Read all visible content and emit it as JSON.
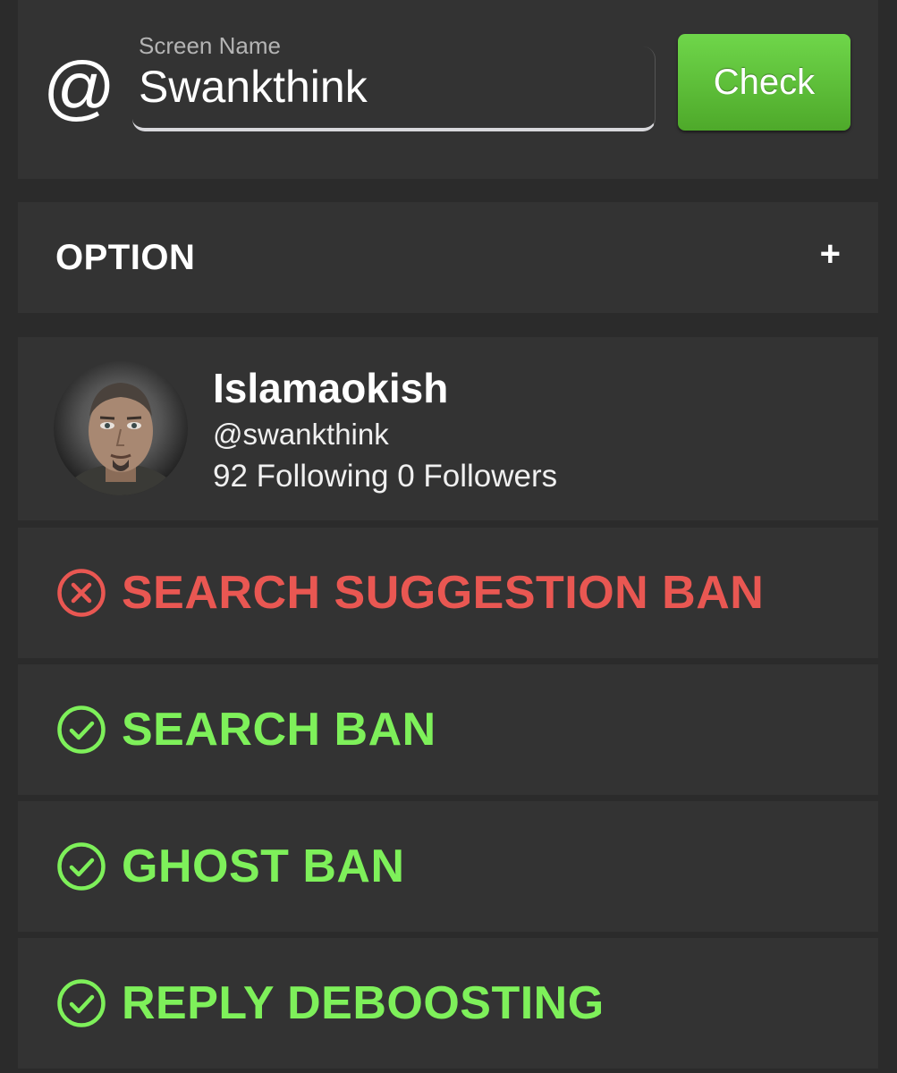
{
  "search": {
    "at_symbol": "@",
    "label": "Screen Name",
    "value": "Swankthink",
    "button_label": "Check"
  },
  "option": {
    "title": "OPTION",
    "expand_symbol": "+"
  },
  "profile": {
    "display_name": "Islamaokish",
    "handle": "@swankthink",
    "counts": "92 Following 0 Followers"
  },
  "results": [
    {
      "label": "SEARCH SUGGESTION BAN",
      "status": "banned",
      "icon": "x-circle-icon",
      "color": "#e95752"
    },
    {
      "label": "SEARCH BAN",
      "status": "ok",
      "icon": "check-circle-icon",
      "color": "#7ef05a"
    },
    {
      "label": "GHOST BAN",
      "status": "ok",
      "icon": "check-circle-icon",
      "color": "#7ef05a"
    },
    {
      "label": "REPLY DEBOOSTING",
      "status": "ok",
      "icon": "check-circle-icon",
      "color": "#7ef05a"
    }
  ]
}
